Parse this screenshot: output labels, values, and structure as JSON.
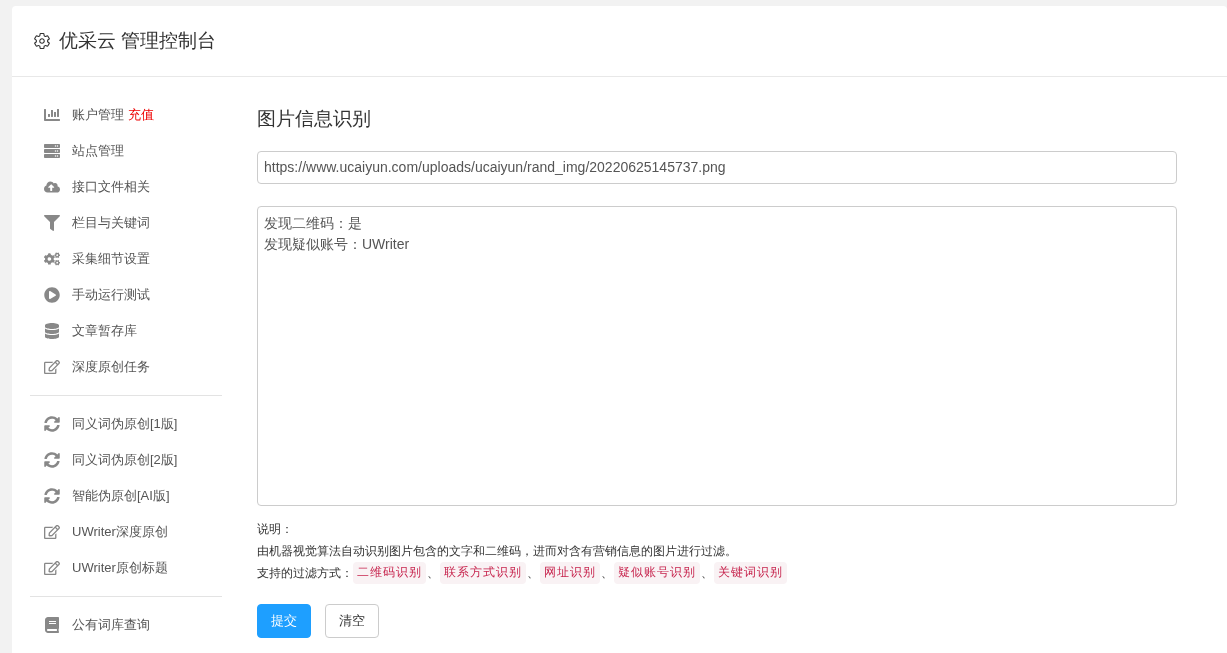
{
  "header": {
    "title": "优采云 管理控制台"
  },
  "sidebar": {
    "groups": [
      {
        "items": [
          {
            "label": "账户管理",
            "kind": "chart",
            "badge": "充值"
          },
          {
            "label": "站点管理",
            "kind": "server"
          },
          {
            "label": "接口文件相关",
            "kind": "cloud"
          },
          {
            "label": "栏目与关键词",
            "kind": "filter"
          },
          {
            "label": "采集细节设置",
            "kind": "cogs"
          },
          {
            "label": "手动运行测试",
            "kind": "play"
          },
          {
            "label": "文章暂存库",
            "kind": "database"
          },
          {
            "label": "深度原创任务",
            "kind": "edit"
          }
        ]
      },
      {
        "items": [
          {
            "label": "同义词伪原创[1版]",
            "kind": "refresh"
          },
          {
            "label": "同义词伪原创[2版]",
            "kind": "refresh"
          },
          {
            "label": "智能伪原创[AI版]",
            "kind": "refresh"
          },
          {
            "label": "UWriter深度原创",
            "kind": "edit"
          },
          {
            "label": "UWriter原创标题",
            "kind": "edit"
          }
        ]
      },
      {
        "items": [
          {
            "label": "公有词库查询",
            "kind": "book"
          }
        ]
      }
    ]
  },
  "main": {
    "title": "图片信息识别",
    "url_field": {
      "value": "https://www.ucaiyun.com/uploads/ucaiyun/rand_img/20220625145737.png"
    },
    "result_box": {
      "lines": [
        "发现二维码：是",
        "发现疑似账号：UWriter"
      ]
    },
    "note_label": "说明：",
    "note_text": "由机器视觉算法自动识别图片包含的文字和二维码，进而对含有营销信息的图片进行过滤。",
    "filters_label": "支持的过滤方式：",
    "filters": [
      "二维码识别",
      "联系方式识别",
      "网址识别",
      "疑似账号识别",
      "关键词识别"
    ],
    "separator": "、",
    "buttons": [
      {
        "label": "提交",
        "kind": "primary"
      },
      {
        "label": "清空",
        "kind": "default"
      }
    ]
  }
}
